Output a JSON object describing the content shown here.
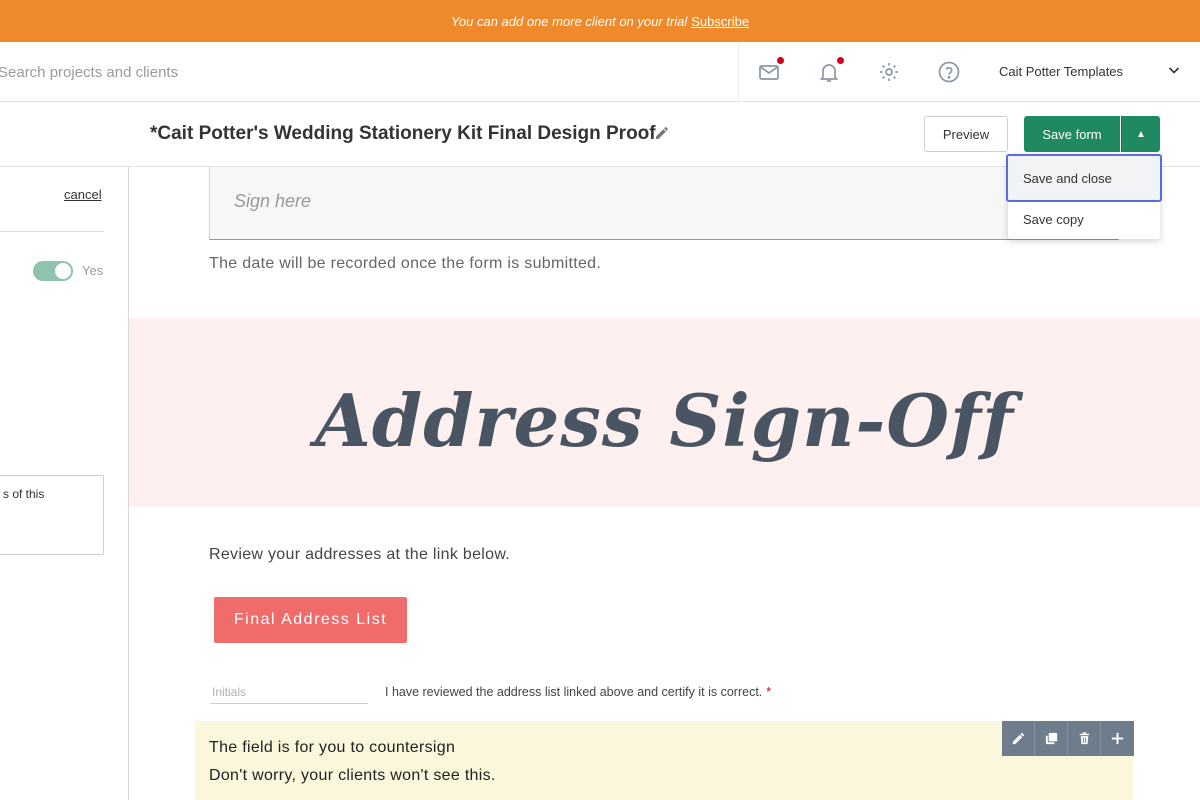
{
  "banner": {
    "text": "You can add one more client on your trial",
    "link": "Subscribe"
  },
  "topnav": {
    "search_placeholder": "Search projects and clients",
    "account_name": "Cait Potter Templates",
    "icons": [
      "mail-icon",
      "bell-icon",
      "gear-icon",
      "help-icon",
      "chevron-down-icon"
    ]
  },
  "form": {
    "title": "*Cait Potter's Wedding Stationery Kit Final Design Proof",
    "preview_label": "Preview",
    "save_label": "Save form",
    "dropdown": {
      "save_and_close": "Save and close",
      "save_copy": "Save copy"
    }
  },
  "left_panel": {
    "cancel": "cancel",
    "toggle_label": "Yes",
    "textarea_text": "s of this"
  },
  "canvas": {
    "sign_placeholder": "Sign here",
    "date_note": "The date will be recorded once the form is submitted.",
    "section_title": "Address Sign-Off",
    "review_text": "Review your addresses at the link below.",
    "address_button": "Final Address List",
    "initials_placeholder": "Initials",
    "certify_text": "I have reviewed the address list linked above and certify it is correct.",
    "required_mark": "*",
    "countersign_line1": "The field is for you to countersign",
    "countersign_line2": "Don't worry, your clients won't see this."
  },
  "colors": {
    "banner": "#ee8a2b",
    "save_button": "#1f8a62",
    "address_button": "#ef6c6b",
    "pink_band": "#fdf0ee",
    "countersign_bg": "#fbf7dc",
    "dropdown_focus": "#5b6bdc"
  }
}
